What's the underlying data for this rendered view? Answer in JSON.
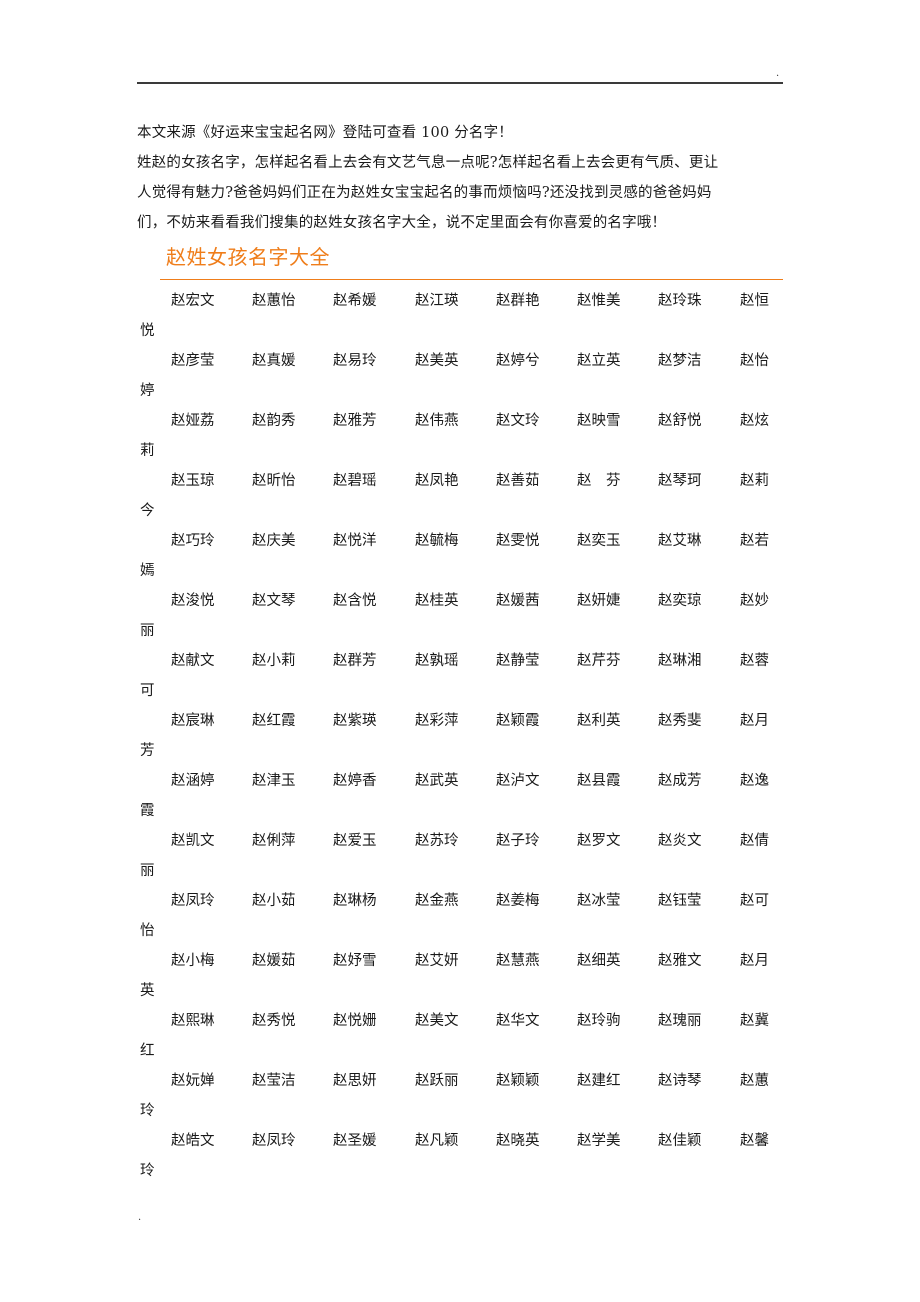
{
  "header": {
    "corner_mark": "."
  },
  "intro": {
    "source_line": "本文来源《好运来宝宝起名网》登陆可查看 100 分名字！",
    "paragraph_lines": [
      "姓赵的女孩名字，怎样起名看上去会有文艺气息一点呢?怎样起名看上去会更有气质、更让",
      "人觉得有魅力?爸爸妈妈们正在为赵姓女宝宝起名的事而烦恼吗?还没找到灵感的爸爸妈妈",
      "们，不妨来看看我们搜集的赵姓女孩名字大全，说不定里面会有你喜爱的名字哦！"
    ]
  },
  "section": {
    "title": "赵姓女孩名字大全",
    "accent_color": "#ef7d1a"
  },
  "name_rows": [
    {
      "names": [
        "赵宏文",
        "赵蕙怡",
        "赵希媛",
        "赵江瑛",
        "赵群艳",
        "赵惟美",
        "赵玲珠",
        "赵恒"
      ],
      "wrap": "悦"
    },
    {
      "names": [
        "赵彦莹",
        "赵真媛",
        "赵易玲",
        "赵美英",
        "赵婷兮",
        "赵立英",
        "赵梦洁",
        "赵怡"
      ],
      "wrap": "婷"
    },
    {
      "names": [
        "赵娅荔",
        "赵韵秀",
        "赵雅芳",
        "赵伟燕",
        "赵文玲",
        "赵映雪",
        "赵舒悦",
        "赵炫"
      ],
      "wrap": "莉"
    },
    {
      "names": [
        "赵玉琼",
        "赵昕怡",
        "赵碧瑶",
        "赵凤艳",
        "赵善茹",
        "赵　芬",
        "赵琴珂",
        "赵莉"
      ],
      "wrap": "今"
    },
    {
      "names": [
        "赵巧玲",
        "赵庆美",
        "赵悦洋",
        "赵毓梅",
        "赵雯悦",
        "赵奕玉",
        "赵艾琳",
        "赵若"
      ],
      "wrap": "嫣"
    },
    {
      "names": [
        "赵浚悦",
        "赵文琴",
        "赵含悦",
        "赵桂英",
        "赵媛茜",
        "赵妍婕",
        "赵奕琼",
        "赵妙"
      ],
      "wrap": "丽"
    },
    {
      "names": [
        "赵献文",
        "赵小莉",
        "赵群芳",
        "赵孰瑶",
        "赵静莹",
        "赵芹芬",
        "赵琳湘",
        "赵蓉"
      ],
      "wrap": "可"
    },
    {
      "names": [
        "赵宸琳",
        "赵红霞",
        "赵紫瑛",
        "赵彩萍",
        "赵颖霞",
        "赵利英",
        "赵秀斐",
        "赵月"
      ],
      "wrap": "芳"
    },
    {
      "names": [
        "赵涵婷",
        "赵津玉",
        "赵婷香",
        "赵武英",
        "赵泸文",
        "赵县霞",
        "赵成芳",
        "赵逸"
      ],
      "wrap": "霞"
    },
    {
      "names": [
        "赵凯文",
        "赵俐萍",
        "赵爱玉",
        "赵苏玲",
        "赵子玲",
        "赵罗文",
        "赵炎文",
        "赵倩"
      ],
      "wrap": "丽"
    },
    {
      "names": [
        "赵凤玲",
        "赵小茹",
        "赵琳杨",
        "赵金燕",
        "赵姜梅",
        "赵冰莹",
        "赵钰莹",
        "赵可"
      ],
      "wrap": "怡"
    },
    {
      "names": [
        "赵小梅",
        "赵媛茹",
        "赵妤雪",
        "赵艾妍",
        "赵慧燕",
        "赵细英",
        "赵雅文",
        "赵月"
      ],
      "wrap": "英"
    },
    {
      "names": [
        "赵熙琳",
        "赵秀悦",
        "赵悦姗",
        "赵美文",
        "赵华文",
        "赵玲驹",
        "赵瑰丽",
        "赵冀"
      ],
      "wrap": "红"
    },
    {
      "names": [
        "赵妧婵",
        "赵莹洁",
        "赵思妍",
        "赵跃丽",
        "赵颖颖",
        "赵建红",
        "赵诗琴",
        "赵蕙"
      ],
      "wrap": "玲"
    },
    {
      "names": [
        "赵皓文",
        "赵凤玲",
        "赵圣媛",
        "赵凡颖",
        "赵晓英",
        "赵学美",
        "赵佳颖",
        "赵馨"
      ],
      "wrap": "玲"
    }
  ],
  "footer": {
    "corner_mark": "."
  }
}
